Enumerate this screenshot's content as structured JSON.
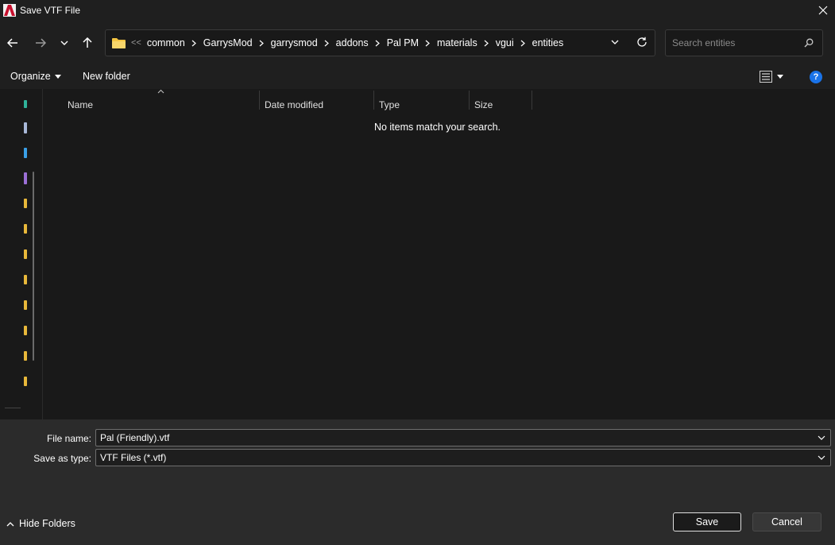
{
  "window": {
    "title": "Save VTF File"
  },
  "address": {
    "overflow": "<<",
    "crumbs": [
      "common",
      "GarrysMod",
      "garrysmod",
      "addons",
      "Pal PM",
      "materials",
      "vgui",
      "entities"
    ]
  },
  "search": {
    "placeholder": "Search entities",
    "value": ""
  },
  "toolbar": {
    "organize_label": "Organize",
    "new_folder_label": "New folder",
    "help_label": "?"
  },
  "nav_pane": {
    "item_colors": [
      "#2fb39a",
      "#a8b8d8",
      "#3aa0e8",
      "#9b6fd6",
      "#e8b83a",
      "#e8b83a",
      "#e8b83a",
      "#e8b83a",
      "#e8b83a",
      "#e8b83a",
      "#e8b83a",
      "#e8b83a"
    ]
  },
  "file_list": {
    "columns": [
      "Name",
      "Date modified",
      "Type",
      "Size"
    ],
    "empty_message": "No items match your search."
  },
  "form": {
    "file_name_label": "File name:",
    "file_name_value": "Pal (Friendly).vtf",
    "save_type_label": "Save as type:",
    "save_type_value": "VTF Files (*.vtf)"
  },
  "footer": {
    "hide_folders_label": "Hide Folders",
    "save_label": "Save",
    "cancel_label": "Cancel"
  }
}
